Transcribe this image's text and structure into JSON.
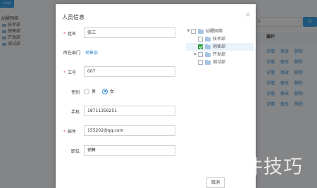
{
  "background": {
    "top_button": "ncel",
    "tree": {
      "root": "幼醒网络",
      "items": [
        "技术部",
        "销售部",
        "开发部",
        "测试部"
      ]
    },
    "search_placeholder": "清",
    "search_button": "Q",
    "table_header": "操作",
    "row_actions": [
      "详情",
      "修改",
      "删除"
    ]
  },
  "modal": {
    "title": "人员信息",
    "close_symbol": "×",
    "form": {
      "name_label": "姓名",
      "name_value": "张三",
      "dept_label": "所在部门",
      "dept_value": "销售部",
      "id_label": "工号",
      "id_value": "007",
      "gender_label": "性别",
      "gender_options": [
        "男",
        "女"
      ],
      "gender_selected": "女",
      "phone_label": "手机",
      "phone_value": "18711359251",
      "email_label": "邮件",
      "email_value": "155202@qq.com",
      "position_label": "职位",
      "position_value": "销售"
    },
    "tree": {
      "root": "幼醒网络",
      "items": [
        {
          "label": "技术部",
          "checked": false,
          "expandable": false
        },
        {
          "label": "销售部",
          "checked": true,
          "expandable": false
        },
        {
          "label": "开发部",
          "checked": false,
          "expandable": true
        },
        {
          "label": "测试部",
          "checked": false,
          "expandable": false
        }
      ],
      "expand_symbol": "▶",
      "collapse_symbol": "▼"
    },
    "cancel_label": "取消"
  },
  "watermark": "软件技巧",
  "colors": {
    "accent": "#3a8fd6",
    "required": "#e54d42",
    "checked": "#38b14a"
  }
}
